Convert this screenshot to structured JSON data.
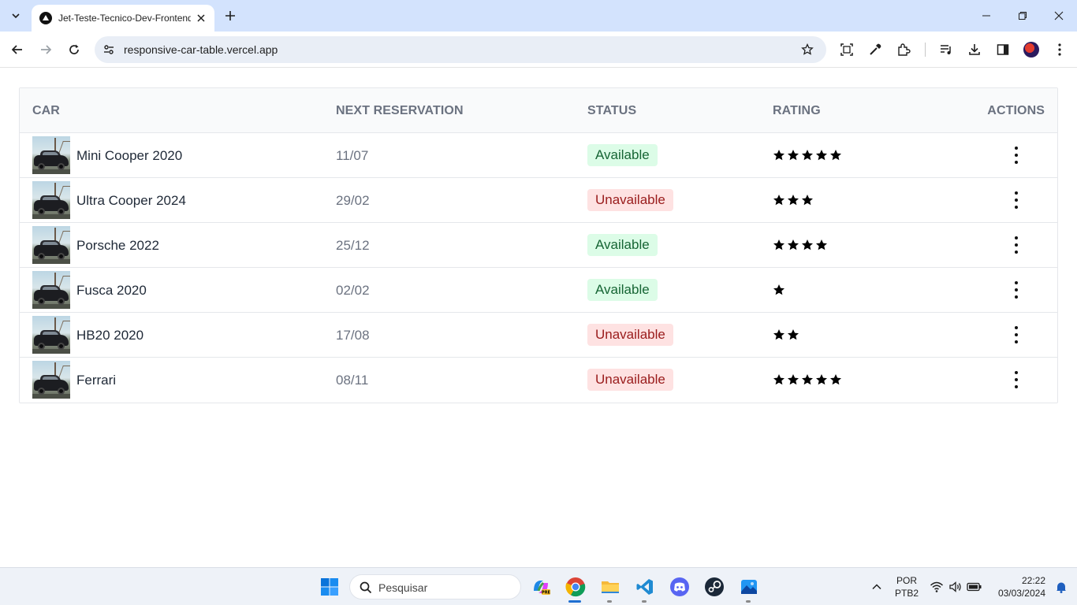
{
  "browser": {
    "tab_title": "Jet-Teste-Tecnico-Dev-Frontend",
    "url": "responsive-car-table.vercel.app"
  },
  "table": {
    "headers": {
      "car": "CAR",
      "next_reservation": "NEXT RESERVATION",
      "status": "STATUS",
      "rating": "RATING",
      "actions": "ACTIONS"
    },
    "rows": [
      {
        "car": "Mini Cooper 2020",
        "next_reservation": "11/07",
        "status": "Available",
        "rating": 5
      },
      {
        "car": "Ultra Cooper 2024",
        "next_reservation": "29/02",
        "status": "Unavailable",
        "rating": 3
      },
      {
        "car": "Porsche 2022",
        "next_reservation": "25/12",
        "status": "Available",
        "rating": 4
      },
      {
        "car": "Fusca 2020",
        "next_reservation": "02/02",
        "status": "Available",
        "rating": 1
      },
      {
        "car": "HB20 2020",
        "next_reservation": "17/08",
        "status": "Unavailable",
        "rating": 2
      },
      {
        "car": "Ferrari",
        "next_reservation": "08/11",
        "status": "Unavailable",
        "rating": 5
      }
    ]
  },
  "colors": {
    "available_bg": "#dcfce7",
    "available_text": "#166534",
    "unavailable_bg": "#fee2e2",
    "unavailable_text": "#991b1b"
  },
  "taskbar": {
    "search_placeholder": "Pesquisar",
    "lang_top": "POR",
    "lang_bottom": "PTB2",
    "time": "22:22",
    "date": "03/03/2024"
  }
}
